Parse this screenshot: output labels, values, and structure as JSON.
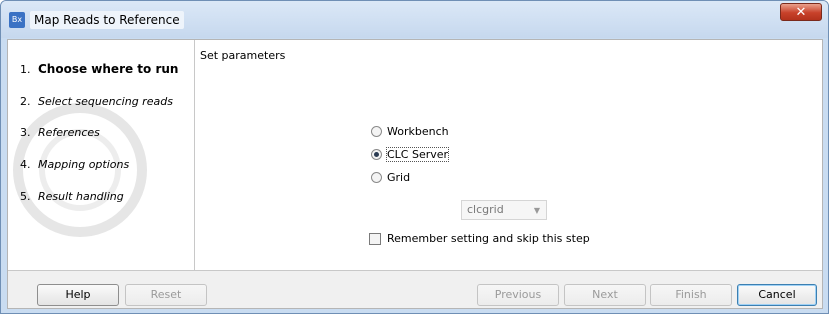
{
  "window": {
    "title": "Map Reads to Reference",
    "app_icon_text": "Bx",
    "close_glyph": "✕"
  },
  "steps": [
    {
      "number": "1.",
      "label": "Choose where to run",
      "current": true
    },
    {
      "number": "2.",
      "label": "Select sequencing reads",
      "current": false
    },
    {
      "number": "3.",
      "label": "References",
      "current": false
    },
    {
      "number": "4.",
      "label": "Mapping options",
      "current": false
    },
    {
      "number": "5.",
      "label": "Result handling",
      "current": false
    }
  ],
  "params": {
    "title": "Set parameters",
    "options": [
      {
        "label": "Workbench",
        "selected": false
      },
      {
        "label": "CLC Server",
        "selected": true
      },
      {
        "label": "Grid",
        "selected": false
      }
    ],
    "grid_select": {
      "value": "clcgrid",
      "enabled": false
    },
    "remember": {
      "label": "Remember setting and skip this step",
      "checked": false
    }
  },
  "footer": {
    "help": "Help",
    "reset": "Reset",
    "previous": "Previous",
    "next": "Next",
    "finish": "Finish",
    "cancel": "Cancel"
  },
  "icons": {
    "app": "app-icon",
    "close": "close-icon",
    "dropdown": "chevron-down-icon"
  }
}
